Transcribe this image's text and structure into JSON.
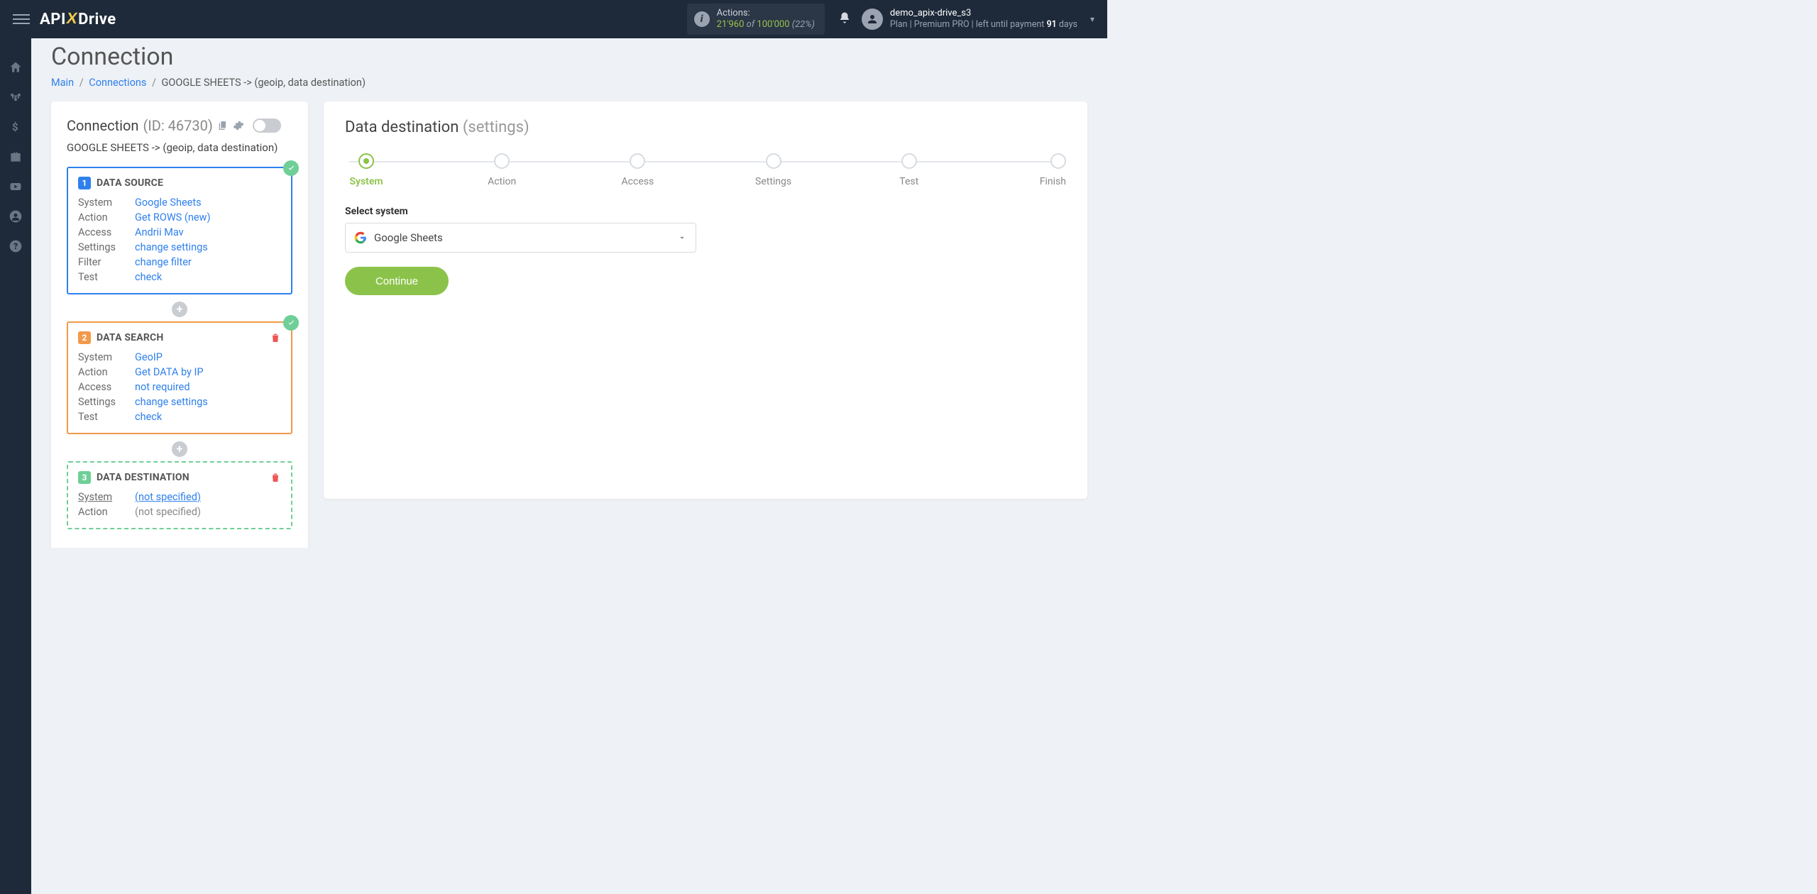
{
  "topbar": {
    "logo_a": "API",
    "logo_x": "X",
    "logo_b": "Drive",
    "actions_label": "Actions:",
    "actions_used": "21'960",
    "actions_of": "of",
    "actions_total": "100'000",
    "actions_pct": "(22%)",
    "username": "demo_apix-drive_s3",
    "plan_prefix": "Plan |",
    "plan_name": "Premium PRO",
    "plan_mid": "| left until payment",
    "plan_days": "91",
    "plan_days_word": "days"
  },
  "page": {
    "title": "Connection",
    "breadcrumb": {
      "main": "Main",
      "connections": "Connections",
      "current": "GOOGLE SHEETS -> (geoip, data destination)"
    }
  },
  "left": {
    "head_title": "Connection",
    "head_id": "(ID: 46730)",
    "sub": "GOOGLE SHEETS -> (geoip, data destination)",
    "box1": {
      "num": "1",
      "title": "DATA SOURCE",
      "rows": [
        {
          "k": "System",
          "v": "Google Sheets",
          "link": true
        },
        {
          "k": "Action",
          "v": "Get ROWS (new)",
          "link": true
        },
        {
          "k": "Access",
          "v": "Andrii Mav",
          "link": true
        },
        {
          "k": "Settings",
          "v": "change settings",
          "link": true
        },
        {
          "k": "Filter",
          "v": "change filter",
          "link": true
        },
        {
          "k": "Test",
          "v": "check",
          "link": true
        }
      ]
    },
    "box2": {
      "num": "2",
      "title": "DATA SEARCH",
      "rows": [
        {
          "k": "System",
          "v": "GeoIP",
          "link": true
        },
        {
          "k": "Action",
          "v": "Get DATA by IP",
          "link": true
        },
        {
          "k": "Access",
          "v": "not required",
          "link": true
        },
        {
          "k": "Settings",
          "v": "change settings",
          "link": true
        },
        {
          "k": "Test",
          "v": "check",
          "link": true
        }
      ]
    },
    "box3": {
      "num": "3",
      "title": "DATA DESTINATION",
      "rows": [
        {
          "k": "System",
          "v": "(not specified)",
          "link": true,
          "underline": true
        },
        {
          "k": "Action",
          "v": "(not specified)",
          "muted": true
        }
      ]
    }
  },
  "right": {
    "title": "Data destination",
    "subtitle": "(settings)",
    "steps": [
      "System",
      "Action",
      "Access",
      "Settings",
      "Test",
      "Finish"
    ],
    "active_step": 0,
    "field_label": "Select system",
    "select_value": "Google Sheets",
    "continue": "Continue"
  }
}
